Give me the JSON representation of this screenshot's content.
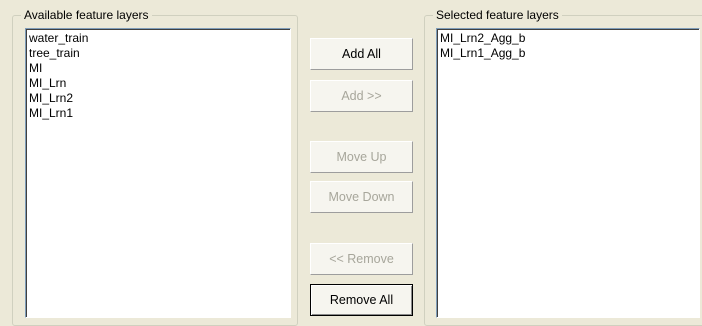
{
  "available": {
    "legend": "Available feature layers",
    "items": [
      "water_train",
      "tree_train",
      "MI",
      "MI_Lrn",
      "MI_Lrn2",
      "MI_Lrn1"
    ]
  },
  "selected": {
    "legend": "Selected feature layers",
    "items": [
      "MI_Lrn2_Agg_b",
      "MI_Lrn1_Agg_b"
    ]
  },
  "buttons": {
    "add_all": "Add All",
    "add": "Add >>",
    "move_up": "Move Up",
    "move_down": "Move Down",
    "remove": "<< Remove",
    "remove_all": "Remove All"
  }
}
